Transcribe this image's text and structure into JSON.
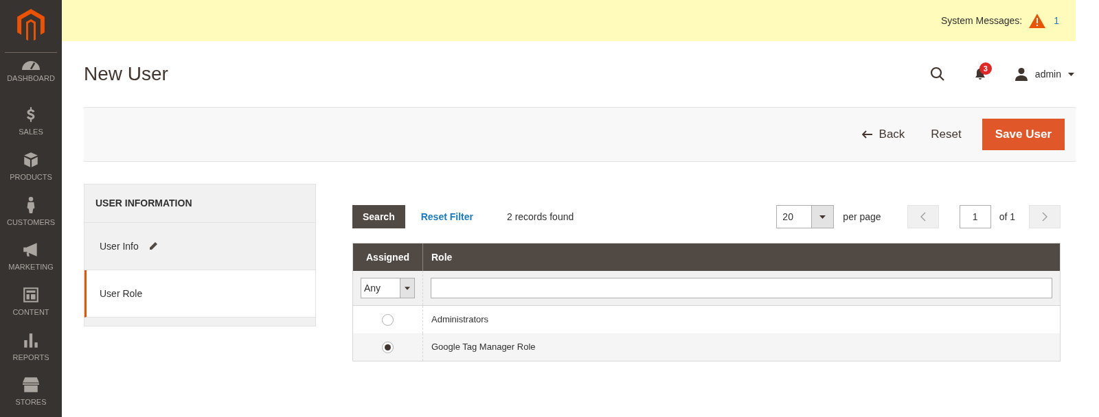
{
  "sidebar": {
    "items": [
      {
        "kind": "dashboard",
        "label": "DASHBOARD"
      },
      {
        "kind": "sales",
        "label": "SALES"
      },
      {
        "kind": "products",
        "label": "PRODUCTS"
      },
      {
        "kind": "customers",
        "label": "CUSTOMERS"
      },
      {
        "kind": "marketing",
        "label": "MARKETING"
      },
      {
        "kind": "content",
        "label": "CONTENT"
      },
      {
        "kind": "reports",
        "label": "REPORTS"
      },
      {
        "kind": "stores",
        "label": "STORES"
      }
    ]
  },
  "system_messages": {
    "label": "System Messages:",
    "count": "1"
  },
  "page_title": "New User",
  "header": {
    "notifications": "3",
    "user": "admin"
  },
  "actions": {
    "back": "Back",
    "reset": "Reset",
    "save": "Save User"
  },
  "tabs_panel": {
    "title": "USER INFORMATION",
    "tabs": [
      {
        "label": "User Info",
        "selected": false,
        "edited": true
      },
      {
        "label": "User Role",
        "selected": true,
        "edited": false
      }
    ]
  },
  "grid": {
    "search": "Search",
    "reset_filter": "Reset Filter",
    "records": "2 records found",
    "per_page_value": "20",
    "per_page_label": "per page",
    "page": "1",
    "page_of": "of 1",
    "columns": [
      "Assigned",
      "Role"
    ],
    "filter_assigned": "Any",
    "rows": [
      {
        "role": "Administrators",
        "selected": false
      },
      {
        "role": "Google Tag Manager Role",
        "selected": true
      }
    ]
  }
}
